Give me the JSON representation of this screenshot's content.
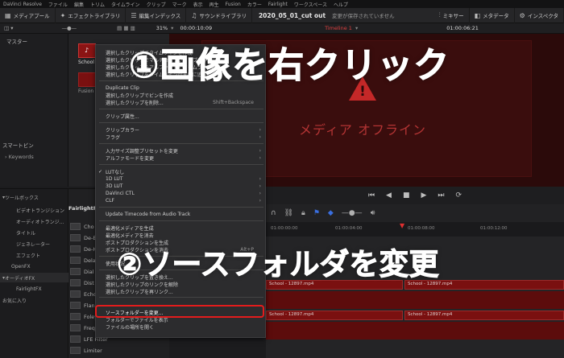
{
  "menubar": [
    "DaVinci Resolve",
    "ファイル",
    "編集",
    "トリム",
    "タイムライン",
    "クリップ",
    "マーク",
    "表示",
    "再生",
    "Fusion",
    "カラー",
    "Fairlight",
    "ワークスペース",
    "ヘルプ"
  ],
  "toolbar": {
    "media_pool": "メディアプール",
    "effects_library": "エフェクトライブラリ",
    "edit_index": "編集インデックス",
    "sound_library": "サウンドライブラリ",
    "project_title": "2020_05_01_cut out",
    "save_status": "変更が保存されていません",
    "mixer": "ミキサー",
    "metadata": "メタデータ",
    "inspector": "インスペクタ"
  },
  "viewer_bar": {
    "zoom": "31%",
    "timecode_left": "00:00:10:09",
    "timeline_name": "Timeline 1",
    "timecode_right": "01:00:06:21"
  },
  "left_panel": {
    "master": "マスター",
    "smart_bins": "スマートビン",
    "keywords": "Keywords"
  },
  "bin": {
    "clip1": "School",
    "clip2": "Fusion"
  },
  "viewer": {
    "offline_text": "メディア オフライン"
  },
  "ruler": {
    "t1": "01:00:00:00",
    "t2": "01:00:04:00",
    "t3": "01:00:08:00",
    "t4": "01:00:12:00"
  },
  "clips": [
    "School - 12897.mp4",
    "School - 12897.mp4",
    "School - 12897.mp4",
    "School - 12897.mp4",
    "School - 12897.mp4"
  ],
  "toolbox": {
    "toolbox": "ツールボックス",
    "video_transitions": "ビデオトランジション",
    "audio_transitions": "オーディオトランジ...",
    "titles": "タイトル",
    "generators": "ジェネレーター",
    "effects": "エフェクト",
    "openfx": "OpenFX",
    "audio_fx": "オーディオFX",
    "fairlightfx": "FairlightFX",
    "favorites": "お気に入り"
  },
  "fx": {
    "header": "FairlightFX",
    "items": [
      "Cho",
      "De-E",
      "De-H",
      "Dela",
      "Dial",
      "Dist",
      "Echo",
      "Flan",
      "Foley",
      "Freq",
      "LFE Filter",
      "Limiter"
    ]
  },
  "context_menu": {
    "items": [
      "選択したクリップでタイムラインを作成",
      "選択したクリップでマルチカメラクリップを作成",
      "選択したクリップをアルファ付きでタイムラインに挿入",
      "選択したクリップをタイムラインの末尾に追加",
      "Duplicate Clip",
      "選択したクリップでビンを作成",
      "選択したクリップを削除...",
      "クリップ属性...",
      "クリップカラー",
      "フラグ",
      "入力サイズ調整プリセットを変更",
      "アルファモードを変更",
      "LUTなし",
      "1D LUT",
      "3D LUT",
      "DaVinci CTL",
      "CLF",
      "Update Timecode from Audio Track",
      "最適化メディアを生成",
      "最適化メディアを消去",
      "ポストプロダクションを生成",
      "ポストプロダクションを消去",
      "使用状況",
      "選択したクリップを置き換え...",
      "選択したクリップのリンクを解除",
      "選択したクリップを再リンク...",
      "ソースフォルダーを変更...",
      "フォルダーでファイルを表示",
      "ファイルの場所を開く"
    ],
    "shortcut_delete": "Shift+Backspace",
    "shortcut_alt": "Alt+P"
  },
  "overlay": {
    "step1": "①画像を右クリック",
    "step2": "②ソースフォルダを変更"
  }
}
